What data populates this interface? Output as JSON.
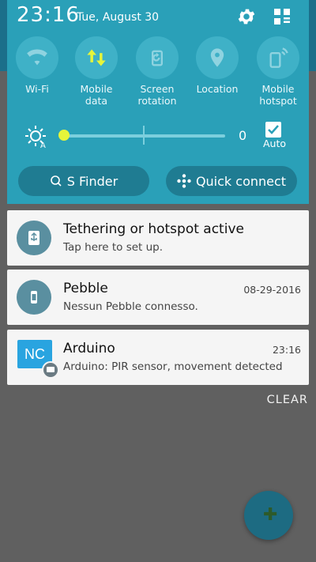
{
  "status": {
    "time": "23:16",
    "date": "Tue, August 30"
  },
  "quick_toggles": [
    {
      "label": "Wi-Fi",
      "icon": "wifi-icon",
      "active": false
    },
    {
      "label": "Mobile data",
      "icon": "mobile-data-icon",
      "active": true
    },
    {
      "label": "Screen rotation",
      "icon": "screen-rotation-icon",
      "active": false
    },
    {
      "label": "Location",
      "icon": "location-icon",
      "active": false
    },
    {
      "label": "Mobile hotspot",
      "icon": "mobile-hotspot-icon",
      "active": false
    }
  ],
  "brightness": {
    "value": "0",
    "level": 0,
    "auto_label": "Auto",
    "auto_checked": true
  },
  "shortcuts": {
    "s_finder": "S Finder",
    "quick_connect": "Quick connect"
  },
  "notifications": [
    {
      "title": "Tethering or hotspot active",
      "text": "Tap here to set up.",
      "time": "",
      "icon": "usb-icon"
    },
    {
      "title": "Pebble",
      "text": "Nessun Pebble connesso.",
      "time": "08-29-2016",
      "icon": "watch-icon"
    },
    {
      "title": "Arduino",
      "text": "Arduino: PIR sensor, movement detected",
      "time": "23:16",
      "icon": "nc-app-icon",
      "icon_text": "NC"
    }
  ],
  "clear_label": "CLEAR",
  "colors": {
    "panel": "#2aa0b8",
    "toggle_active": "#e6f53a",
    "nc_blue": "#29a4e0"
  }
}
